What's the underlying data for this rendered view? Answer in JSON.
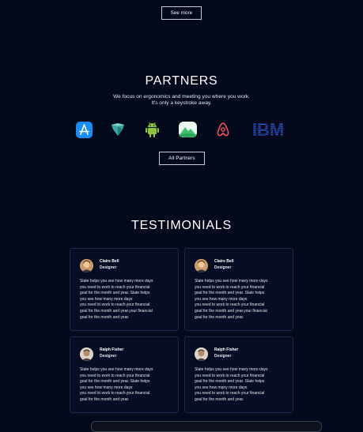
{
  "top": {
    "see_more_label": "See more"
  },
  "partners": {
    "title": "PARTNERS",
    "subtitle_line1": "We focus on ergonomics and meeting you where you work.",
    "subtitle_line2": "It's only a keystroke away.",
    "logos": [
      {
        "name": "app-store-icon",
        "color": "#1b8df2"
      },
      {
        "name": "gem-logo-icon",
        "color": "#3aa7a3"
      },
      {
        "name": "android-icon",
        "color": "#8ec43a"
      },
      {
        "name": "landscape-app-icon",
        "color": "#3fbf6d"
      },
      {
        "name": "airbnb-icon",
        "color": "#f0515b"
      },
      {
        "name": "ibm-logo",
        "text": "IBM",
        "color": "#2a5bd7"
      }
    ],
    "all_partners_label": "All Partners"
  },
  "testimonials": {
    "title": "TESTIMONIALS",
    "cards": [
      {
        "name": "Claire Bell",
        "role": "Designer",
        "lines": [
          "Slate helps you see how many more days",
          "you need to work to reach your financial",
          "goal for the month and year. Slate helps",
          "you see how many more days",
          "you need to work to reach your financial",
          "goal for the month and year.your financial",
          "goal for the month and year."
        ]
      },
      {
        "name": "Claire Bell",
        "role": "Designer",
        "lines": [
          "Slate helps you see how many more days",
          "you need to work to reach your financial",
          "goal for the month and year. Slate helps",
          "you see how many more days",
          "you need to work to reach your financial",
          "goal for the month and year.your financial",
          "goal for the month and year."
        ]
      },
      {
        "name": "Ralph Fisher",
        "role": "Designer",
        "lines": [
          "Slate helps you see how many more days",
          "you need to work to reach your financial",
          "goal for the month and year. Slate helps",
          "you see how many more days",
          "you need to work to reach your financial",
          "goal for the month and year."
        ]
      },
      {
        "name": "Ralph Fisher",
        "role": "Designer",
        "lines": [
          "Slate helps you see how many more days",
          "you need to work to reach your financial",
          "goal for the month and year. Slate helps",
          "you see how many more days",
          "you need to work to reach your financial",
          "goal for the month and year."
        ]
      }
    ]
  }
}
